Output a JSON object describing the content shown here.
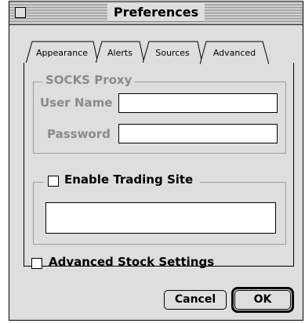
{
  "window": {
    "title": "Preferences"
  },
  "tabs": [
    {
      "label": "Appearance",
      "active": false
    },
    {
      "label": "Alerts",
      "active": false
    },
    {
      "label": "Sources",
      "active": false
    },
    {
      "label": "Advanced",
      "active": true
    }
  ],
  "socks_proxy": {
    "group_label": "SOCKS Proxy",
    "user_name_label": "User Name",
    "user_name_value": "",
    "password_label": "Password",
    "password_value": "",
    "enabled": false
  },
  "trading_site": {
    "checkbox_label": "Enable Trading Site",
    "checked": false,
    "value": ""
  },
  "advanced_stock": {
    "checkbox_label": "Advanced Stock Settings",
    "checked": false
  },
  "buttons": {
    "cancel_label": "Cancel",
    "ok_label": "OK"
  }
}
